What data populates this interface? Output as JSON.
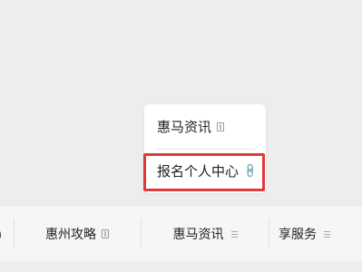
{
  "popup": {
    "items": [
      {
        "label": "惠马资讯",
        "icon": "page-icon"
      },
      {
        "label": "报名个人中心",
        "icon": "link-icon"
      }
    ],
    "highlight_color": "#e0393b"
  },
  "menubar": {
    "left_fragment": ")",
    "items": [
      {
        "label": "惠州攻略",
        "icon": "page-icon"
      },
      {
        "label": "惠马资讯",
        "icon": "menu-lines-icon"
      },
      {
        "label": "享服务",
        "icon": "menu-lines-icon"
      }
    ]
  }
}
